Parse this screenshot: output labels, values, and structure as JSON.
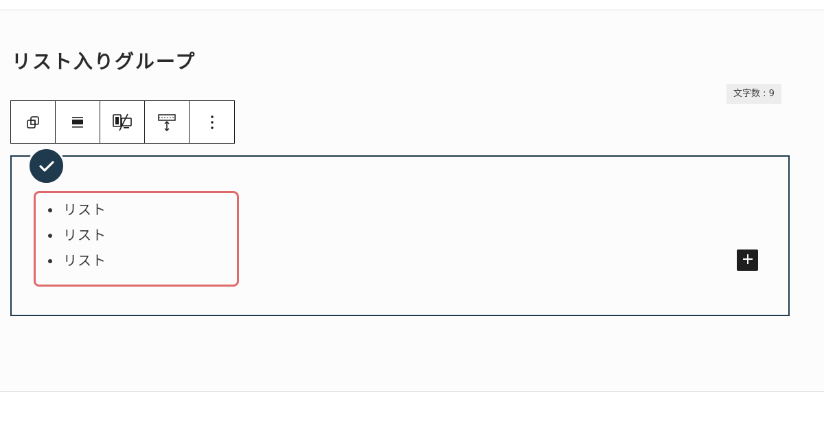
{
  "page": {
    "title": "リスト入りグループ",
    "char_count": "文字数 : 9"
  },
  "toolbar": {
    "buttons": [
      {
        "icon": "group-block-icon",
        "label": "Group"
      },
      {
        "icon": "align-wide-icon",
        "label": "Align"
      },
      {
        "icon": "device-visibility-icon",
        "label": "Device visibility"
      },
      {
        "icon": "spacing-icon",
        "label": "Spacing"
      },
      {
        "icon": "more-options-icon",
        "label": "Options"
      }
    ]
  },
  "group": {
    "list": {
      "items": [
        "リスト",
        "リスト",
        "リスト"
      ]
    }
  },
  "colors": {
    "group_border": "#1f3b4d",
    "badge": "#1e3a4c",
    "list_highlight": "#e06b6b",
    "add_button": "#1e1e1e"
  }
}
